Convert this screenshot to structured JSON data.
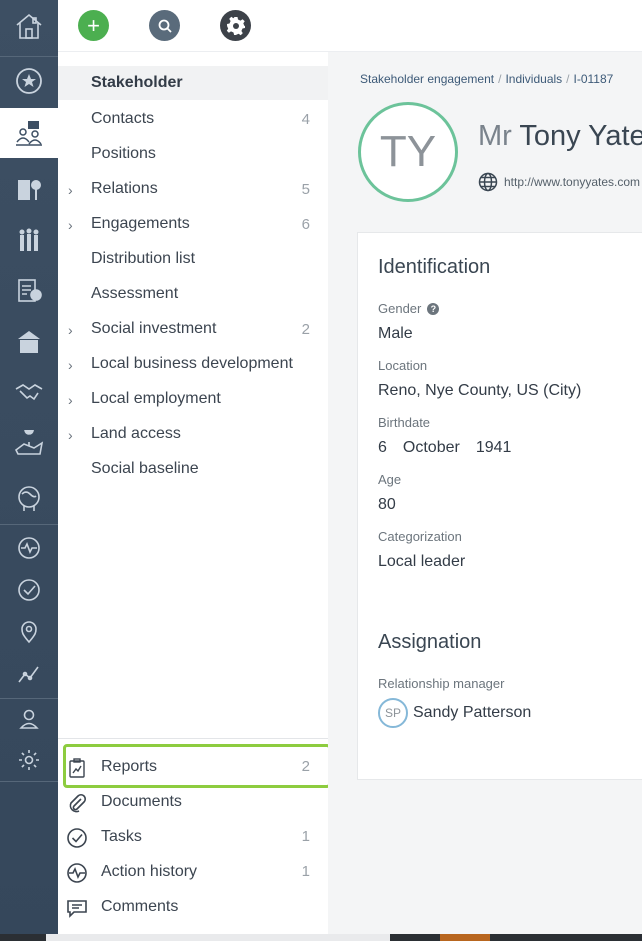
{
  "toolbar": {
    "add_label": "+"
  },
  "rail": {
    "items": [
      "home-icon",
      "favorites-icon",
      "stakeholders-icon",
      "organizations-icon",
      "groups-icon",
      "forms-icon",
      "communities-icon",
      "handshake-icon",
      "land-icon",
      "environment-icon",
      "activity-icon",
      "tasks-icon",
      "location-icon",
      "analytics-icon",
      "user-icon",
      "settings-icon"
    ],
    "active": "stakeholders-icon"
  },
  "subnav": {
    "items": [
      {
        "label": "Stakeholder",
        "count": "",
        "expandable": false,
        "selected": true
      },
      {
        "label": "Contacts",
        "count": "4",
        "expandable": false
      },
      {
        "label": "Positions",
        "count": "",
        "expandable": false
      },
      {
        "label": "Relations",
        "count": "5",
        "expandable": true
      },
      {
        "label": "Engagements",
        "count": "6",
        "expandable": true
      },
      {
        "label": "Distribution list",
        "count": "",
        "expandable": false
      },
      {
        "label": "Assessment",
        "count": "",
        "expandable": false
      },
      {
        "label": "Social investment",
        "count": "2",
        "expandable": true
      },
      {
        "label": "Local business development",
        "count": "",
        "expandable": true
      },
      {
        "label": "Local employment",
        "count": "",
        "expandable": true
      },
      {
        "label": "Land access",
        "count": "",
        "expandable": true
      },
      {
        "label": "Social baseline",
        "count": "",
        "expandable": false
      }
    ],
    "chevron": "›",
    "bottom": [
      {
        "label": "Reports",
        "count": "2",
        "icon": "report-icon"
      },
      {
        "label": "Documents",
        "count": "",
        "icon": "paperclip-icon"
      },
      {
        "label": "Tasks",
        "count": "1",
        "icon": "check-circle-icon"
      },
      {
        "label": "Action history",
        "count": "1",
        "icon": "activity-icon"
      },
      {
        "label": "Comments",
        "count": "",
        "icon": "comment-icon"
      }
    ]
  },
  "breadcrumb": {
    "items": [
      "Stakeholder engagement",
      "Individuals",
      "I-01187"
    ],
    "separator": "/"
  },
  "person": {
    "initials": "TY",
    "salutation": "Mr",
    "name": "Tony Yates",
    "website": "http://www.tonyyates.com"
  },
  "identification": {
    "title": "Identification",
    "gender_label": "Gender",
    "gender": "Male",
    "location_label": "Location",
    "location": "Reno, Nye County, US (City)",
    "birthdate_label": "Birthdate",
    "birth_day": "6",
    "birth_month": "October",
    "birth_year": "1941",
    "age_label": "Age",
    "age": "80",
    "categorization_label": "Categorization",
    "categorization": "Local leader"
  },
  "assignation": {
    "title": "Assignation",
    "manager_label": "Relationship manager",
    "manager_initials": "SP",
    "manager_name": "Sandy Patterson"
  },
  "colors": {
    "rail": "#3d4f63",
    "accent_green": "#4caf50",
    "highlight": "#8dcc3f",
    "avatar_ring": "#6cc39a"
  }
}
